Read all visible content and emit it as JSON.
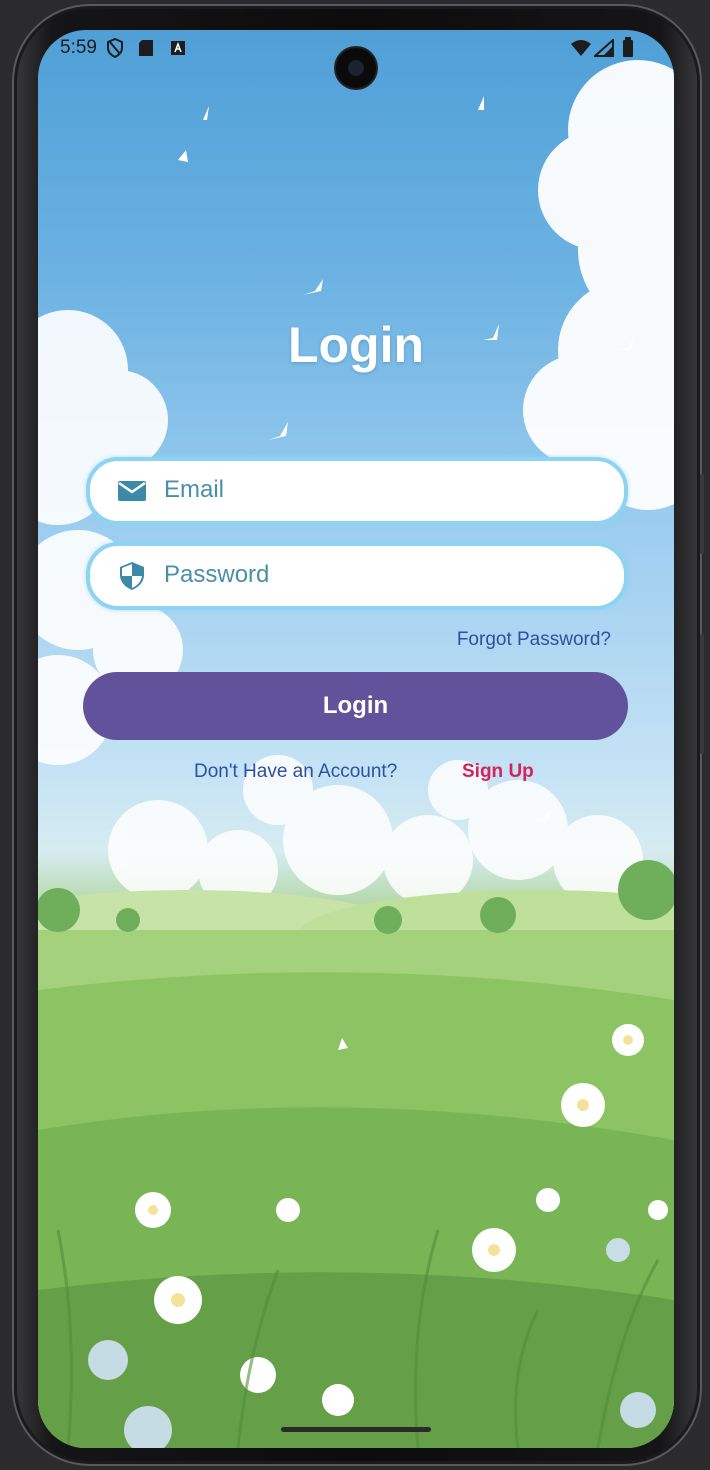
{
  "status_bar": {
    "time": "5:59"
  },
  "screen": {
    "title": "Login",
    "email_field": {
      "placeholder": "Email",
      "icon": "email-icon"
    },
    "password_field": {
      "placeholder": "Password",
      "icon": "shield-icon"
    },
    "forgot_password": "Forgot Password?",
    "login_button": "Login",
    "no_account_text": "Don't Have an Account?",
    "sign_up_link": "Sign Up"
  },
  "colors": {
    "button": "#62529c",
    "field_border": "#8fd3f2",
    "link": "#2f4fa1",
    "sign_up": "#d2245a"
  }
}
